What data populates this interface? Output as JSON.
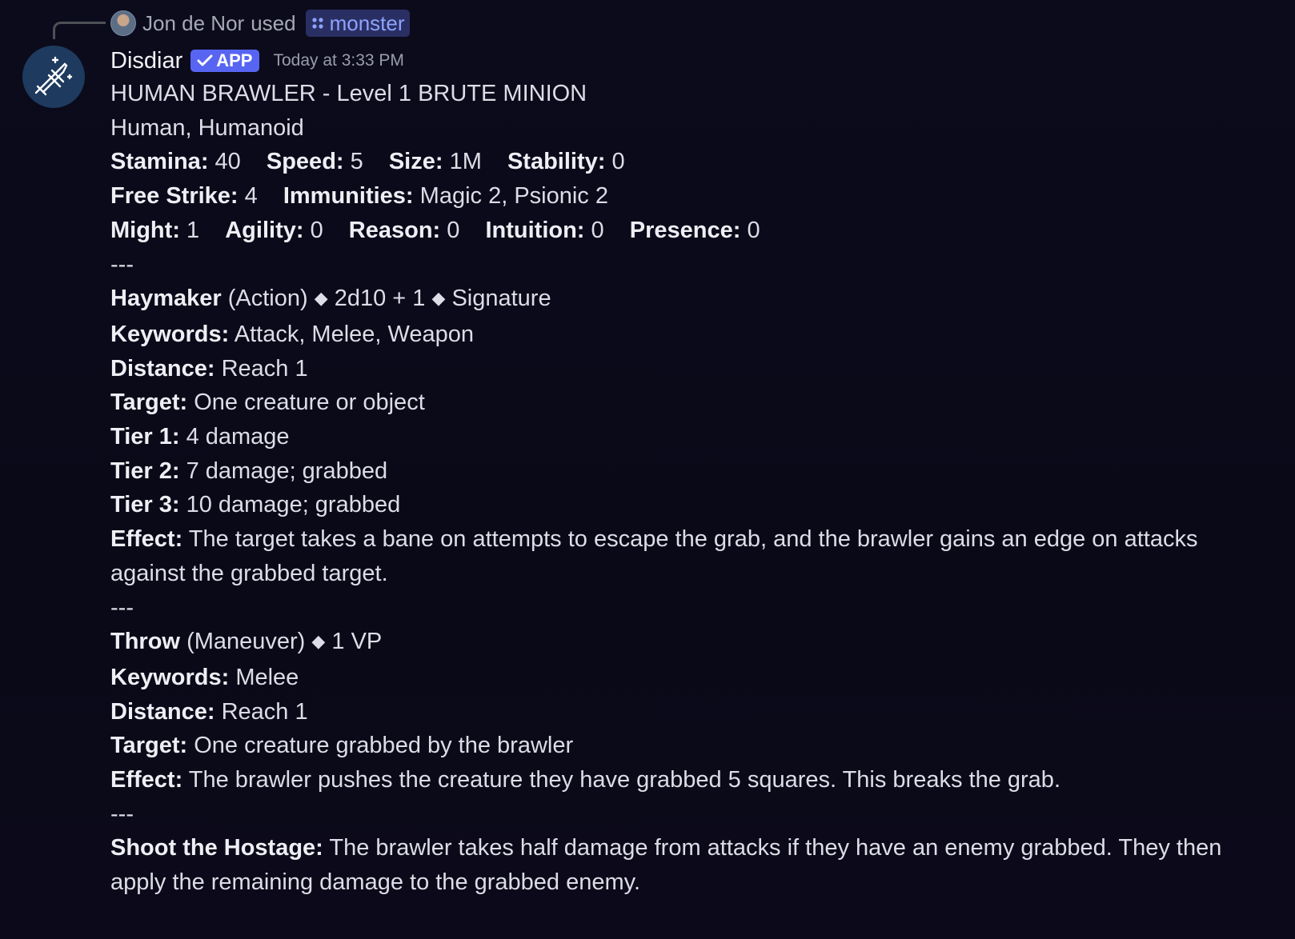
{
  "reply": {
    "user": "Jon de Nor",
    "used": "used",
    "command": "monster"
  },
  "message": {
    "author": "Disdiar",
    "badge": "APP",
    "timestamp": "Today at 3:33 PM",
    "title": "HUMAN BRAWLER - Level 1 BRUTE MINION",
    "subtitle": "Human, Humanoid",
    "stats": {
      "stamina_label": "Stamina:",
      "stamina": "40",
      "speed_label": "Speed:",
      "speed": "5",
      "size_label": "Size:",
      "size": "1M",
      "stability_label": "Stability:",
      "stability": "0",
      "free_strike_label": "Free Strike:",
      "free_strike": "4",
      "immunities_label": "Immunities:",
      "immunities": "Magic 2, Psionic 2",
      "might_label": "Might:",
      "might": "1",
      "agility_label": "Agility:",
      "agility": "0",
      "reason_label": "Reason:",
      "reason": "0",
      "intuition_label": "Intuition:",
      "intuition": "0",
      "presence_label": "Presence:",
      "presence": "0"
    },
    "separator": "---",
    "haymaker": {
      "name": "Haymaker",
      "type": "(Action)",
      "roll": "2d10 + 1",
      "tag": "Signature",
      "keywords_label": "Keywords:",
      "keywords": "Attack, Melee, Weapon",
      "distance_label": "Distance:",
      "distance": "Reach 1",
      "target_label": "Target:",
      "target": "One creature or object",
      "tier1_label": "Tier 1:",
      "tier1": "4 damage",
      "tier2_label": "Tier 2:",
      "tier2": "7 damage; grabbed",
      "tier3_label": "Tier 3:",
      "tier3": "10 damage; grabbed",
      "effect_label": "Effect:",
      "effect": "The target takes a bane on attempts to escape the grab, and the brawler gains an edge on attacks against the grabbed target."
    },
    "throw": {
      "name": "Throw",
      "type": "(Maneuver)",
      "cost": "1 VP",
      "keywords_label": "Keywords:",
      "keywords": "Melee",
      "distance_label": "Distance:",
      "distance": "Reach 1",
      "target_label": "Target:",
      "target": "One creature grabbed by the brawler",
      "effect_label": "Effect:",
      "effect": "The brawler pushes the creature they have grabbed 5 squares. This breaks the grab."
    },
    "trait": {
      "name": "Shoot the Hostage:",
      "text": "The brawler takes half damage from attacks if they have an enemy grabbed. They then apply the remaining damage to the grabbed enemy."
    },
    "diamond": "◆"
  },
  "colors": {
    "background": "#0b0b1c",
    "text": "#dcdde6",
    "badge": "#5865f2",
    "command_pill": "#2a2f63",
    "command_text": "#8ea3ff"
  },
  "icons": {
    "reply_avatar": "user-avatar",
    "command": "app-command-icon",
    "bot_avatar": "sword-sparkle-icon",
    "badge_check": "checkmark-icon"
  }
}
